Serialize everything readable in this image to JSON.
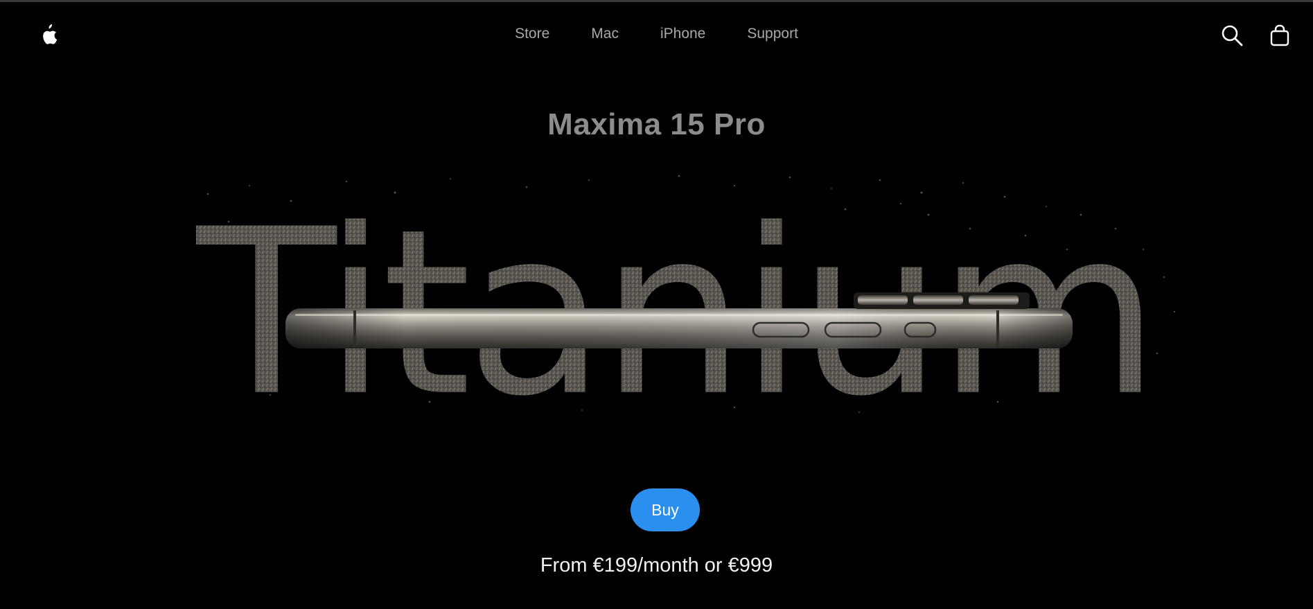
{
  "nav": {
    "logo_icon": "apple-logo-icon",
    "links": [
      {
        "label": "Store"
      },
      {
        "label": "Mac"
      },
      {
        "label": "iPhone"
      },
      {
        "label": "Support"
      }
    ],
    "search_icon": "search-icon",
    "bag_icon": "shopping-bag-icon"
  },
  "hero": {
    "title": "Maxima 15 Pro",
    "art_word": "Titanium",
    "buy_label": "Buy",
    "price_text": "From €199/month or €999"
  },
  "colors": {
    "background": "#000000",
    "accent": "#2b8ff0",
    "title": "#8c8c8c",
    "nav_text": "#a8a8a8"
  }
}
